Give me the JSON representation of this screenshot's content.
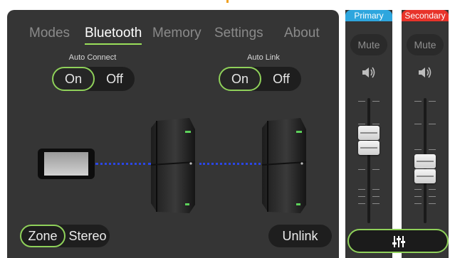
{
  "tabs": [
    {
      "label": "Modes",
      "active": false
    },
    {
      "label": "Bluetooth",
      "active": true
    },
    {
      "label": "Memory",
      "active": false
    },
    {
      "label": "Settings",
      "active": false
    },
    {
      "label": "About",
      "active": false
    }
  ],
  "auto_connect": {
    "label": "Auto Connect",
    "on_label": "On",
    "off_label": "Off",
    "selected": "On"
  },
  "auto_link": {
    "label": "Auto Link",
    "on_label": "On",
    "off_label": "Off",
    "selected": "On"
  },
  "zone_stereo": {
    "zone_label": "Zone",
    "stereo_label": "Stereo",
    "selected": "Zone"
  },
  "unlink_label": "Unlink",
  "channels": [
    {
      "label": "Primary",
      "color": "#2ea6de",
      "mute_label": "Mute",
      "fader_level": 0.78
    },
    {
      "label": "Secondary",
      "color": "#e8332a",
      "mute_label": "Mute",
      "fader_level": 0.55
    }
  ],
  "colors": {
    "accent": "#8fd15a",
    "link": "#2a46e8",
    "panel": "#353535"
  },
  "icons": {
    "speaker": "speaker-volume-icon",
    "mixer": "mixer-sliders-icon"
  }
}
